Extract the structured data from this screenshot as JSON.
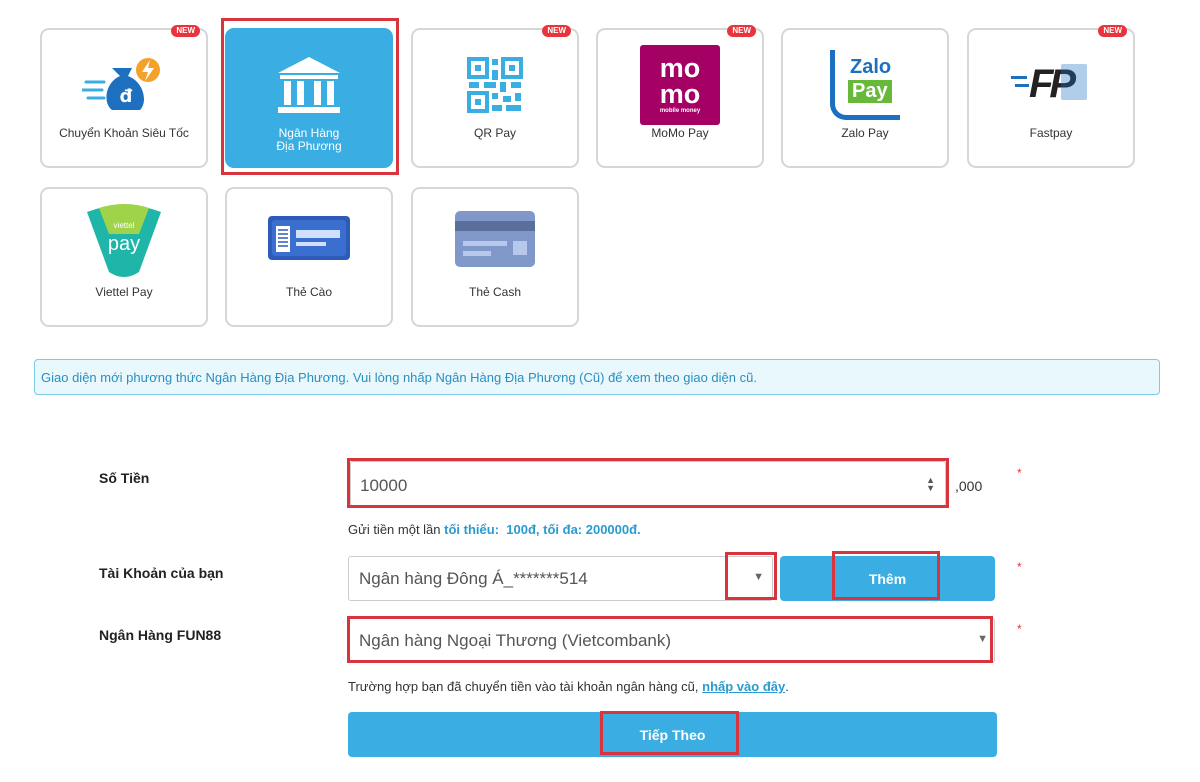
{
  "tiles": [
    {
      "label": "Chuyển Khoản Siêu Tốc",
      "badge": "NEW"
    },
    {
      "label_line1": "Ngân Hàng",
      "label_line2": "Địa Phương"
    },
    {
      "label": "QR Pay",
      "badge": "NEW"
    },
    {
      "label": "MoMo Pay",
      "badge": "NEW"
    },
    {
      "label": "Zalo Pay"
    },
    {
      "label": "Fastpay",
      "badge": "NEW"
    },
    {
      "label": "Viettel Pay"
    },
    {
      "label": "Thẻ Cào"
    },
    {
      "label": "Thẻ Cash"
    }
  ],
  "logos": {
    "momo_top": "mo",
    "momo_bottom": "mo",
    "momo_sub": "mobile money",
    "zalo_top": "Zalo",
    "zalo_bottom": "Pay",
    "fastpay": "FP",
    "viettel_top": "viettel",
    "viettel_bottom": "pay",
    "transfer_symbol": "đ"
  },
  "notice": "Giao diện mới phương thức Ngân Hàng Địa Phương. Vui lòng nhấp Ngân Hàng Địa Phương (Cũ) để xem theo giao diện cũ.",
  "form": {
    "amount": {
      "label": "Số Tiền",
      "value": "10000",
      "suffix": ",000",
      "hint_prefix": "Gửi tiền một lần",
      "hint_min": "tối thiểu:",
      "hint_values": "100đ, tối đa: 200000đ."
    },
    "account": {
      "label": "Tài Khoản của bạn",
      "value": "Ngân hàng Đông Á_*******514",
      "add_button": "Thêm"
    },
    "bank": {
      "label": "Ngân Hàng FUN88",
      "value": "Ngân hàng Ngoại Thương (Vietcombank)",
      "hint_prefix": "Trường hợp bạn đã chuyển tiền vào tài khoản ngân hàng cũ,",
      "hint_link": "nhấp vào đây",
      "hint_suffix": "."
    },
    "required_mark": "*",
    "next_button": "Tiếp Theo"
  },
  "colors": {
    "accent": "#3aaee2",
    "highlight": "#d8343d",
    "badge": "#e8343d",
    "momo": "#a50064"
  }
}
